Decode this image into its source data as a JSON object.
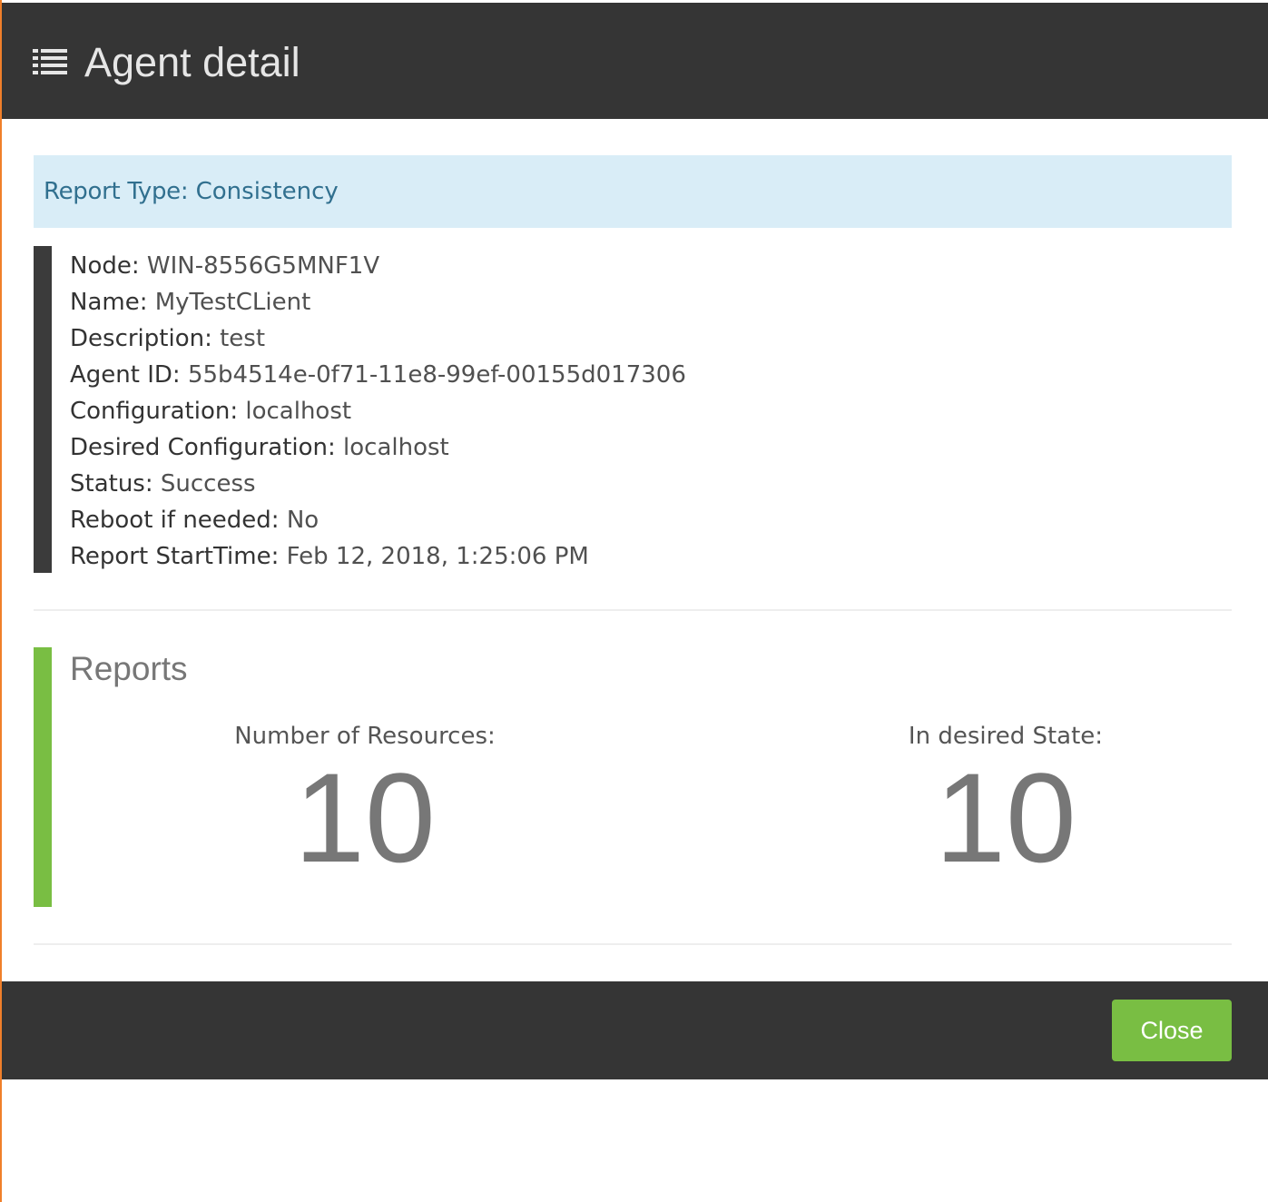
{
  "header": {
    "title": "Agent detail",
    "icon": "list-icon"
  },
  "alert": {
    "label": "Report Type:",
    "value": "Consistency"
  },
  "details": [
    {
      "label": "Node:",
      "value": "WIN-8556G5MNF1V"
    },
    {
      "label": "Name:",
      "value": "MyTestCLient"
    },
    {
      "label": "Description:",
      "value": "test"
    },
    {
      "label": "Agent ID:",
      "value": "55b4514e-0f71-11e8-99ef-00155d017306"
    },
    {
      "label": "Configuration:",
      "value": "localhost"
    },
    {
      "label": "Desired Configuration:",
      "value": "localhost"
    },
    {
      "label": "Status:",
      "value": "Success"
    },
    {
      "label": "Reboot if needed:",
      "value": "No"
    },
    {
      "label": "Report StartTime:",
      "value": "Feb 12, 2018, 1:25:06 PM"
    }
  ],
  "reports": {
    "heading": "Reports",
    "number_of_resources_label": "Number of Resources:",
    "number_of_resources": "10",
    "in_desired_state_label": "In desired State:",
    "in_desired_state": "10"
  },
  "footer": {
    "close_label": "Close"
  },
  "colors": {
    "header_bg": "#353535",
    "alert_bg": "#d9edf7",
    "alert_text": "#31708f",
    "details_bar": "#3b3b3b",
    "reports_bar": "#79be43",
    "button_bg": "#79be43",
    "left_accent": "#f07f2a"
  }
}
